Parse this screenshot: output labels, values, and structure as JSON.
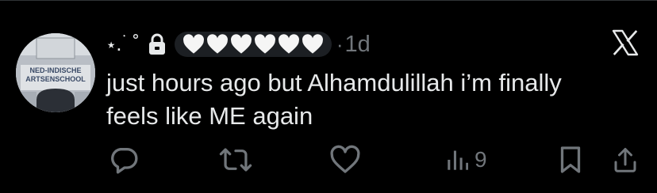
{
  "tweet": {
    "display_name": "⋆. ࣪ ˚",
    "badges": {
      "lock_icon": "lock-icon",
      "heart_icon": "white-heart-icon",
      "heart_count": 6
    },
    "separator": "·",
    "timestamp": "1d",
    "text": "just hours ago but Alhamdulillah i’m finally\nfeels like ME again",
    "avatar": {
      "sign_line_1": "NED-INDISCHE",
      "sign_line_2": "ARTSENSCHOOL"
    }
  },
  "header_icons": {
    "close": "x-icon"
  },
  "actions": {
    "reply": "reply-icon",
    "retweet": "retweet-icon",
    "like": "like-icon",
    "views": {
      "icon": "views-icon",
      "count": "9"
    },
    "bookmark": "bookmark-icon",
    "share": "share-icon"
  },
  "colors": {
    "background": "#000000",
    "text": "#e7e9ea",
    "muted": "#71767b",
    "pill": "#1c1f23"
  }
}
